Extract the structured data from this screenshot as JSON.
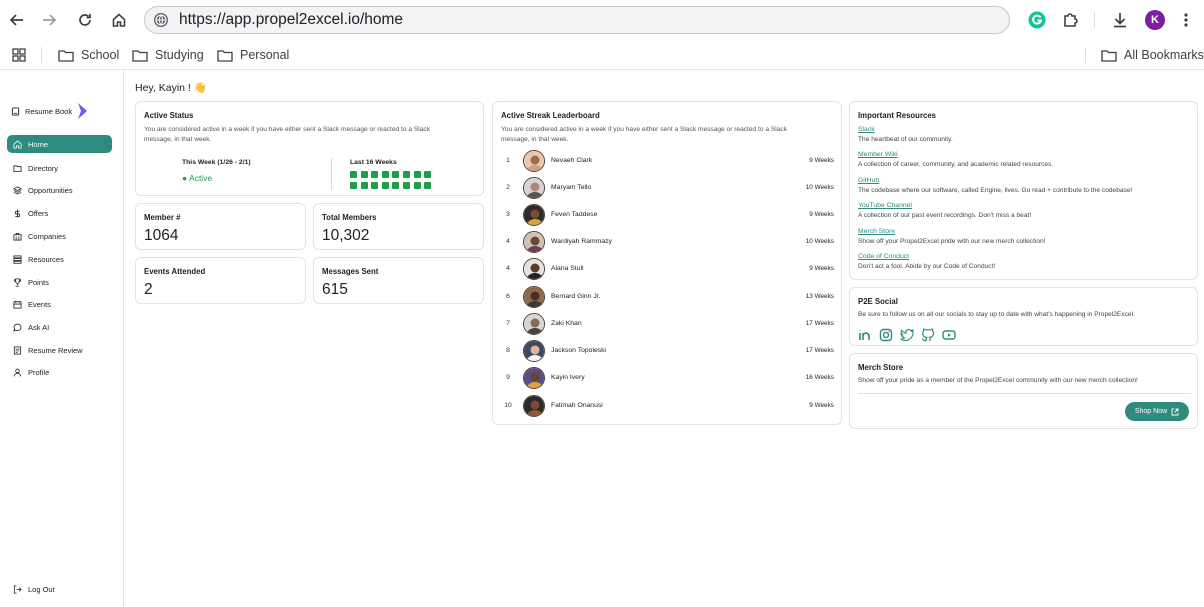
{
  "browser": {
    "url": "https://app.propel2excel.io/home",
    "profile_initial": "K"
  },
  "bookmarks": {
    "items": [
      "School",
      "Studying",
      "Personal"
    ],
    "all": "All Bookmarks"
  },
  "sidebar": {
    "brand": "Resume Book",
    "items": [
      {
        "label": "Home",
        "icon": "home-icon",
        "active": true
      },
      {
        "label": "Directory",
        "icon": "folder-icon"
      },
      {
        "label": "Opportunities",
        "icon": "layers-icon"
      },
      {
        "label": "Offers",
        "icon": "dollar-icon"
      },
      {
        "label": "Companies",
        "icon": "building-icon"
      },
      {
        "label": "Resources",
        "icon": "stack-icon"
      },
      {
        "label": "Points",
        "icon": "trophy-icon"
      },
      {
        "label": "Events",
        "icon": "calendar-icon"
      },
      {
        "label": "Ask AI",
        "icon": "chat-icon"
      },
      {
        "label": "Resume Review",
        "icon": "document-icon"
      },
      {
        "label": "Profile",
        "icon": "user-icon"
      }
    ],
    "logout": "Log Out"
  },
  "greeting": "Hey, Kayin ! 👋",
  "active_status": {
    "title": "Active Status",
    "desc_line1": "You are considered active in a week if you have either sent a Slack message or reacted to a Slack",
    "desc_line2": "message, in that week.",
    "this_week_label": "This Week (1/26 - 2/1)",
    "status": "● Active",
    "last16_label": "Last 16 Weeks",
    "last16_active_weeks": 16
  },
  "stats": [
    {
      "label": "Member #",
      "value": "1064"
    },
    {
      "label": "Total Members",
      "value": "10,302"
    },
    {
      "label": "Events Attended",
      "value": "2"
    },
    {
      "label": "Messages Sent",
      "value": "615"
    }
  ],
  "leaderboard": {
    "title": "Active Streak Leaderboard",
    "desc_line1": "You are considered active in a week if you have either sent a Slack message or reacted to a Slack",
    "desc_line2": "message, in that week.",
    "rows": [
      {
        "rank": "1",
        "name": "Nevaeh Clark",
        "weeks": "9 Weeks"
      },
      {
        "rank": "2",
        "name": "Maryam Tello",
        "weeks": "10 Weeks"
      },
      {
        "rank": "3",
        "name": "Feven Taddese",
        "weeks": "9 Weeks"
      },
      {
        "rank": "4",
        "name": "Wardiyah Rammazy",
        "weeks": "10 Weeks"
      },
      {
        "rank": "4",
        "name": "Alana Stull",
        "weeks": "9 Weeks"
      },
      {
        "rank": "6",
        "name": "Bernard Ginn Jr.",
        "weeks": "13 Weeks"
      },
      {
        "rank": "7",
        "name": "Zaki Khan",
        "weeks": "17 Weeks"
      },
      {
        "rank": "8",
        "name": "Jackson Topoleski",
        "weeks": "17 Weeks"
      },
      {
        "rank": "9",
        "name": "Kayin Ivery",
        "weeks": "16 Weeks"
      },
      {
        "rank": "10",
        "name": "Fatimah Onanusi",
        "weeks": "9 Weeks"
      }
    ]
  },
  "resources": {
    "title": "Important Resources",
    "items": [
      {
        "link": "Slack",
        "desc": "The heartbeat of our community."
      },
      {
        "link": "Member Wiki",
        "desc": "A collection of career, community, and academic related resources."
      },
      {
        "link": "GitHub",
        "desc": "The codebase where our software, called Engine, lives. Go read + contribute to the codebase!"
      },
      {
        "link": "YouTube Channel",
        "desc": "A collection of our past event recordings. Don't miss a beat!"
      },
      {
        "link": "Merch Store",
        "desc": "Show off your Propel2Excel pride with our new merch collection!"
      },
      {
        "link": "Code of Conduct",
        "desc": "Don't act a fool. Abide by our Code of Conduct!"
      }
    ]
  },
  "social": {
    "title": "P2E Social",
    "desc": "Be sure to follow us on all our socials to stay up to date with what's happening in Propel2Excel.",
    "icons": [
      "linkedin-icon",
      "instagram-icon",
      "twitter-icon",
      "github-icon",
      "youtube-icon"
    ]
  },
  "merch": {
    "title": "Merch Store",
    "desc": "Show off your pride as a member of the Propel2Excel community with our new merch collection!",
    "button": "Shop Now"
  },
  "colors": {
    "accent": "#2e8b7e",
    "active_green": "#1e9e4a"
  }
}
